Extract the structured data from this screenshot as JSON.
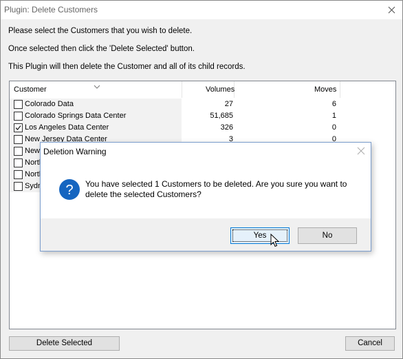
{
  "window": {
    "title": "Plugin: Delete Customers"
  },
  "instructions": [
    "Please select the Customers that you wish to delete.",
    "Once selected then click the 'Delete Selected' button.",
    "This Plugin will then delete the Customer and all of its child records."
  ],
  "grid": {
    "headers": {
      "customer": "Customer",
      "volumes": "Volumes",
      "moves": "Moves"
    },
    "rows": [
      {
        "name": "Colorado Data",
        "volumes": "27",
        "moves": "6",
        "checked": false
      },
      {
        "name": "Colorado Springs Data Center",
        "volumes": "51,685",
        "moves": "1",
        "checked": false
      },
      {
        "name": "Los Angeles Data Center",
        "volumes": "326",
        "moves": "0",
        "checked": true
      },
      {
        "name": "New Jersey Data Center",
        "volumes": "3",
        "moves": "0",
        "checked": false
      },
      {
        "name": "New",
        "volumes": "",
        "moves": "",
        "checked": false
      },
      {
        "name": "North",
        "volumes": "",
        "moves": "",
        "checked": false
      },
      {
        "name": "North",
        "volumes": "",
        "moves": "",
        "checked": false
      },
      {
        "name": "Sydn",
        "volumes": "",
        "moves": "",
        "checked": false
      }
    ]
  },
  "buttons": {
    "delete_selected": "Delete Selected",
    "cancel": "Cancel"
  },
  "dialog": {
    "title": "Deletion Warning",
    "message_line1": "You have selected 1 Customers to be deleted. Are you sure you want to",
    "message_line2": "delete the selected Customers?",
    "yes": "Yes",
    "no": "No"
  },
  "colors": {
    "question_icon": "#1565c0",
    "focus_button_bg": "#e5f1fb",
    "focus_button_border": "#0078d7"
  },
  "icons": {
    "title_close": "close-icon",
    "dialog_close": "close-icon",
    "dialog_icon": "question-icon"
  }
}
